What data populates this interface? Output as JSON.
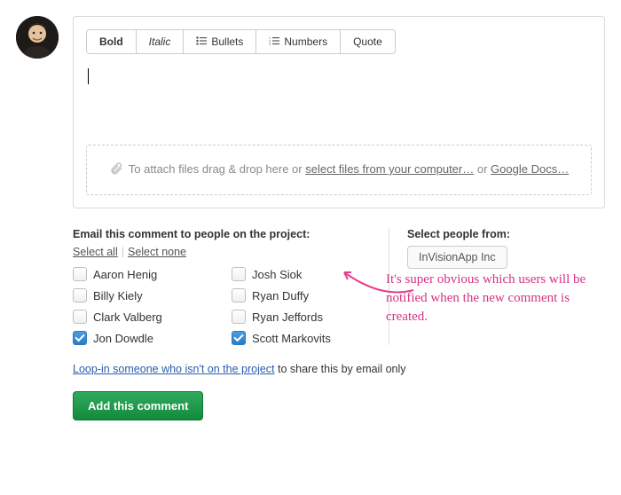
{
  "toolbar": {
    "bold": "Bold",
    "italic": "Italic",
    "bullets": "Bullets",
    "numbers": "Numbers",
    "quote": "Quote"
  },
  "dropzone": {
    "prefix": "To attach files drag & drop here or ",
    "select_files": "select files from your computer…",
    "or": " or ",
    "google_docs": "Google Docs…"
  },
  "notify": {
    "label": "Email this comment to people on the project:",
    "select_all": "Select all",
    "select_none": "Select none",
    "people": [
      {
        "name": "Aaron Henig",
        "checked": false
      },
      {
        "name": "Josh Siok",
        "checked": false
      },
      {
        "name": "Billy Kiely",
        "checked": false
      },
      {
        "name": "Ryan Duffy",
        "checked": false
      },
      {
        "name": "Clark Valberg",
        "checked": false
      },
      {
        "name": "Ryan Jeffords",
        "checked": false
      },
      {
        "name": "Jon Dowdle",
        "checked": true
      },
      {
        "name": "Scott Markovits",
        "checked": true
      }
    ]
  },
  "company": {
    "label": "Select people from:",
    "name": "InVisionApp Inc"
  },
  "annotation": "It's super obvious which users will be notified when the new comment is created.",
  "loop_in": {
    "link": "Loop-in someone who isn't on the project",
    "suffix": " to share this by email only"
  },
  "submit": "Add this comment"
}
